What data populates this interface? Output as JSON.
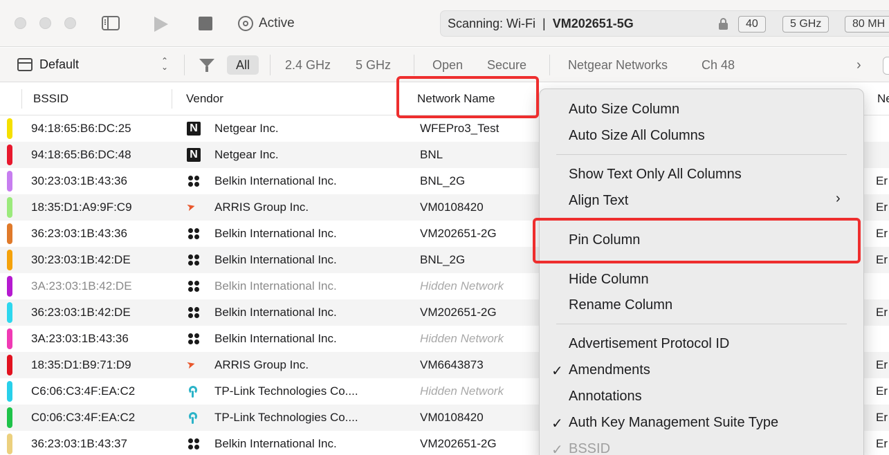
{
  "titlebar": {
    "status_label": "Active",
    "scan_prefix": "Scanning: Wi-Fi  |  ",
    "scan_network": "VM202651-5G",
    "chips": [
      "40",
      "5 GHz",
      "80 MH"
    ]
  },
  "filterbar": {
    "preset": "Default",
    "stepper": "⌃⌄",
    "filters": {
      "all": "All",
      "band_24": "2.4 GHz",
      "band_5": "5 GHz",
      "open": "Open",
      "secure": "Secure",
      "netgear": "Netgear Networks",
      "channel": "Ch 48"
    },
    "more": "›"
  },
  "table": {
    "headers": {
      "bssid": "BSSID",
      "vendor": "Vendor",
      "network_name": "Network Name",
      "right_partial": "Ne"
    },
    "rows": [
      {
        "color": "#f5e000",
        "bssid": "94:18:65:B6:DC:25",
        "vendor": "Netgear Inc.",
        "vendor_icon": "netgear",
        "name": "WFEPro3_Test",
        "hidden": false,
        "dim": false,
        "right": ""
      },
      {
        "color": "#e8182d",
        "bssid": "94:18:65:B6:DC:48",
        "vendor": "Netgear Inc.",
        "vendor_icon": "netgear",
        "name": "BNL",
        "hidden": false,
        "dim": false,
        "right": ""
      },
      {
        "color": "#c77ef0",
        "bssid": "30:23:03:1B:43:36",
        "vendor": "Belkin International Inc.",
        "vendor_icon": "belkin",
        "name": "BNL_2G",
        "hidden": false,
        "dim": false,
        "right": "Er"
      },
      {
        "color": "#9bea7c",
        "bssid": "18:35:D1:A9:9F:C9",
        "vendor": "ARRIS Group Inc.",
        "vendor_icon": "arris",
        "name": "VM0108420",
        "hidden": false,
        "dim": false,
        "right": "Er"
      },
      {
        "color": "#e07a2a",
        "bssid": "36:23:03:1B:43:36",
        "vendor": "Belkin International Inc.",
        "vendor_icon": "belkin",
        "name": "VM202651-2G",
        "hidden": false,
        "dim": false,
        "right": "Er"
      },
      {
        "color": "#f5a20a",
        "bssid": "30:23:03:1B:42:DE",
        "vendor": "Belkin International Inc.",
        "vendor_icon": "belkin",
        "name": "BNL_2G",
        "hidden": false,
        "dim": false,
        "right": "Er"
      },
      {
        "color": "#b51ad0",
        "bssid": "3A:23:03:1B:42:DE",
        "vendor": "Belkin International Inc.",
        "vendor_icon": "belkin",
        "name": "Hidden Network",
        "hidden": true,
        "dim": true,
        "right": ""
      },
      {
        "color": "#2ed7ee",
        "bssid": "36:23:03:1B:42:DE",
        "vendor": "Belkin International Inc.",
        "vendor_icon": "belkin",
        "name": "VM202651-2G",
        "hidden": false,
        "dim": false,
        "right": "Er"
      },
      {
        "color": "#f03ab4",
        "bssid": "3A:23:03:1B:43:36",
        "vendor": "Belkin International Inc.",
        "vendor_icon": "belkin",
        "name": "Hidden Network",
        "hidden": true,
        "dim": false,
        "right": ""
      },
      {
        "color": "#e2121f",
        "bssid": "18:35:D1:B9:71:D9",
        "vendor": "ARRIS Group Inc.",
        "vendor_icon": "arris",
        "name": "VM6643873",
        "hidden": false,
        "dim": false,
        "right": "Er"
      },
      {
        "color": "#28d0ea",
        "bssid": "C6:06:C3:4F:EA:C2",
        "vendor": "TP-Link Technologies Co....",
        "vendor_icon": "tplink",
        "name": "Hidden Network",
        "hidden": true,
        "dim": false,
        "right": "Er"
      },
      {
        "color": "#1fc34a",
        "bssid": "C0:06:C3:4F:EA:C2",
        "vendor": "TP-Link Technologies Co....",
        "vendor_icon": "tplink",
        "name": "VM0108420",
        "hidden": false,
        "dim": false,
        "right": "Er"
      },
      {
        "color": "#ecd07e",
        "bssid": "36:23:03:1B:43:37",
        "vendor": "Belkin International Inc.",
        "vendor_icon": "belkin",
        "name": "VM202651-2G",
        "hidden": false,
        "dim": false,
        "right": "Er"
      }
    ]
  },
  "context_menu": {
    "auto_size_column": "Auto Size Column",
    "auto_size_all": "Auto Size All Columns",
    "show_text_only": "Show Text Only All Columns",
    "align_text": "Align Text",
    "submenu_arrow": "›",
    "pin_column": "Pin Column",
    "hide_column": "Hide Column",
    "rename_column": "Rename Column",
    "columns": [
      {
        "label": "Advertisement Protocol ID",
        "checked": false,
        "disabled": false
      },
      {
        "label": "Amendments",
        "checked": true,
        "disabled": false
      },
      {
        "label": "Annotations",
        "checked": false,
        "disabled": false
      },
      {
        "label": "Auth Key Management Suite Type",
        "checked": true,
        "disabled": false
      },
      {
        "label": "BSSID",
        "checked": true,
        "disabled": true
      }
    ],
    "checkmark": "✓"
  },
  "highlight_color": "#ee2e2e"
}
